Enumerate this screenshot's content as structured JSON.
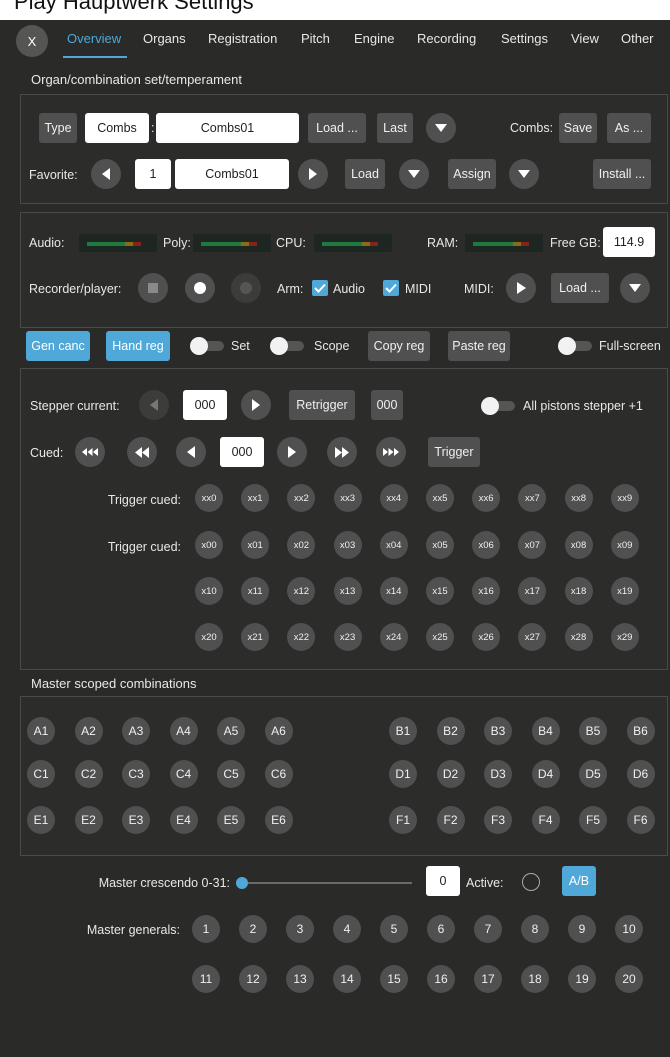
{
  "top_strip_text": "Play Hauptwerk Settings",
  "close_label": "X",
  "tabs": [
    {
      "label": "Overview",
      "active": true
    },
    {
      "label": "Organs"
    },
    {
      "label": "Registration"
    },
    {
      "label": "Pitch"
    },
    {
      "label": "Engine"
    },
    {
      "label": "Recording"
    },
    {
      "label": "Settings"
    },
    {
      "label": "View"
    },
    {
      "label": "Other"
    }
  ],
  "organ_section": {
    "title": "Organ/combination set/temperament",
    "type_label": "Type",
    "type_value": "Combs",
    "colon": ":",
    "name_value": "Combs01",
    "load_label": "Load ...",
    "last_label": "Last",
    "combs_label": "Combs:",
    "save_label": "Save",
    "as_label": "As ...",
    "favorite_label": "Favorite:",
    "favorite_index": "1",
    "favorite_name": "Combs01",
    "fav_load_label": "Load",
    "assign_label": "Assign",
    "install_label": "Install ..."
  },
  "status_section": {
    "audio_label": "Audio:",
    "poly_label": "Poly:",
    "cpu_label": "CPU:",
    "ram_label": "RAM:",
    "free_gb_label": "Free GB:",
    "free_gb_value": "114.9",
    "recorder_label": "Recorder/player:",
    "arm_label": "Arm:",
    "audio_check_label": "Audio",
    "midi_check_label": "MIDI",
    "midi_label": "MIDI:",
    "midi_load_label": "Load ..."
  },
  "controls_row": {
    "gen_canc_label": "Gen canc",
    "hand_reg_label": "Hand reg",
    "set_label": "Set",
    "scope_label": "Scope",
    "copy_reg_label": "Copy reg",
    "paste_reg_label": "Paste reg",
    "full_screen_label": "Full-screen"
  },
  "stepper_section": {
    "stepper_current_label": "Stepper current:",
    "stepper_value": "000",
    "retrigger_label": "Retrigger",
    "retrigger_value": "000",
    "all_pistons_label": "All pistons stepper +1",
    "cued_label": "Cued:",
    "cued_value": "000",
    "trigger_label": "Trigger",
    "trigger_cued_label": "Trigger cued:",
    "row1": [
      "xx0",
      "xx1",
      "xx2",
      "xx3",
      "xx4",
      "xx5",
      "xx6",
      "xx7",
      "xx8",
      "xx9"
    ],
    "row2": [
      "x00",
      "x01",
      "x02",
      "x03",
      "x04",
      "x05",
      "x06",
      "x07",
      "x08",
      "x09"
    ],
    "row3": [
      "x10",
      "x11",
      "x12",
      "x13",
      "x14",
      "x15",
      "x16",
      "x17",
      "x18",
      "x19"
    ],
    "row4": [
      "x20",
      "x21",
      "x22",
      "x23",
      "x24",
      "x25",
      "x26",
      "x27",
      "x28",
      "x29"
    ]
  },
  "master_section": {
    "title": "Master scoped combinations",
    "rows": [
      [
        "A1",
        "A2",
        "A3",
        "A4",
        "A5",
        "A6",
        "B1",
        "B2",
        "B3",
        "B4",
        "B5",
        "B6"
      ],
      [
        "C1",
        "C2",
        "C3",
        "C4",
        "C5",
        "C6",
        "D1",
        "D2",
        "D3",
        "D4",
        "D5",
        "D6"
      ],
      [
        "E1",
        "E2",
        "E3",
        "E4",
        "E5",
        "E6",
        "F1",
        "F2",
        "F3",
        "F4",
        "F5",
        "F6"
      ]
    ]
  },
  "crescendo": {
    "label": "Master crescendo 0-31:",
    "value": "0",
    "level": 0,
    "active_label": "Active:",
    "ab_label": "A/B"
  },
  "generals": {
    "label": "Master generals:",
    "row1": [
      "1",
      "2",
      "3",
      "4",
      "5",
      "6",
      "7",
      "8",
      "9",
      "10"
    ],
    "row2": [
      "11",
      "12",
      "13",
      "14",
      "15",
      "16",
      "17",
      "18",
      "19",
      "20"
    ]
  },
  "colors": {
    "accent": "#4fa8d8",
    "background": "#2a2a28",
    "button": "#505050"
  }
}
